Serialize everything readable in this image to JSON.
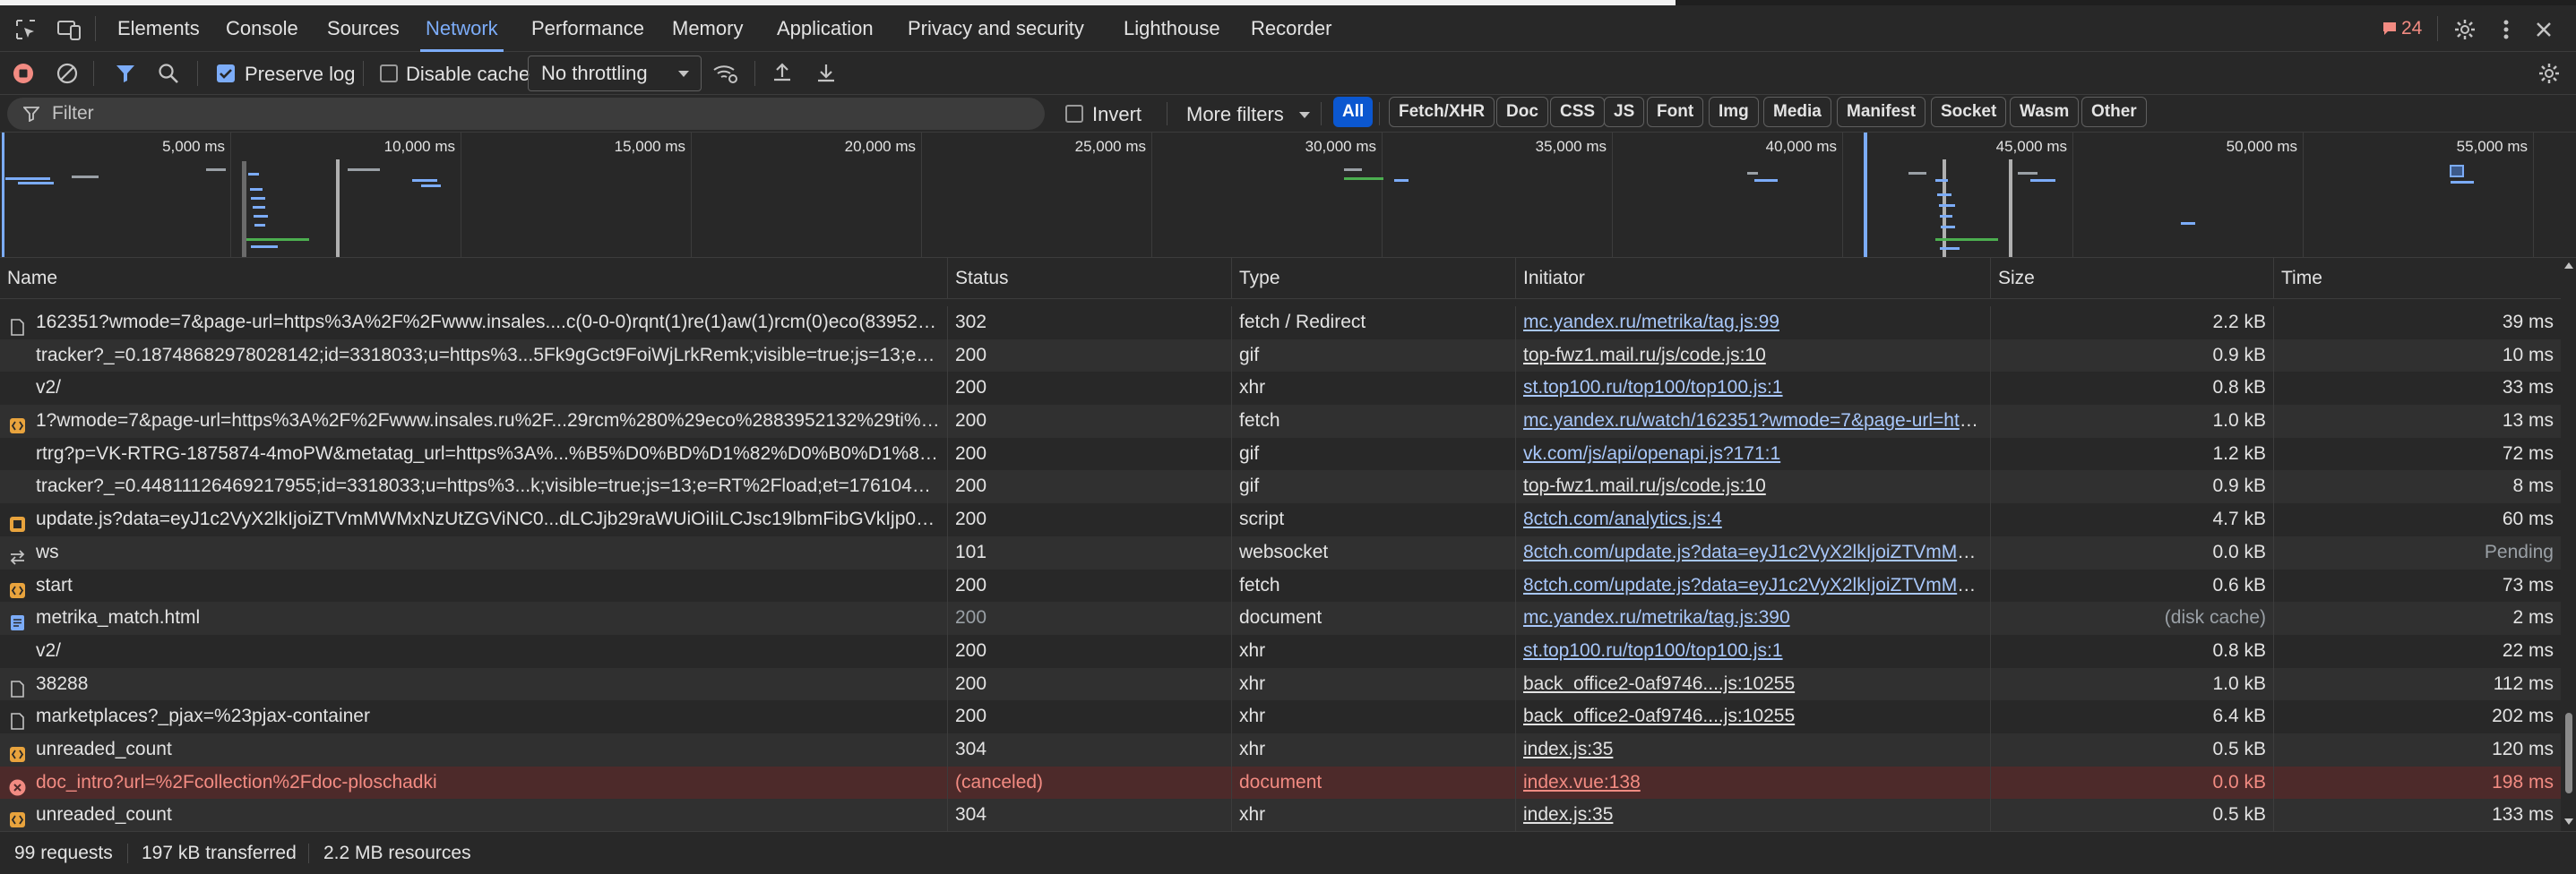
{
  "tabs": [
    {
      "label": "Elements"
    },
    {
      "label": "Console"
    },
    {
      "label": "Sources"
    },
    {
      "label": "Network"
    },
    {
      "label": "Performance"
    },
    {
      "label": "Memory"
    },
    {
      "label": "Application"
    },
    {
      "label": "Privacy and security"
    },
    {
      "label": "Lighthouse"
    },
    {
      "label": "Recorder"
    }
  ],
  "issues_count": "24",
  "toolbar": {
    "preserve_log": "Preserve log",
    "disable_cache": "Disable cache",
    "throttling": "No throttling"
  },
  "filterbar": {
    "placeholder": "Filter",
    "invert": "Invert",
    "more_filters": "More filters",
    "chips": [
      "All",
      "Fetch/XHR",
      "Doc",
      "CSS",
      "JS",
      "Font",
      "Img",
      "Media",
      "Manifest",
      "Socket",
      "Wasm",
      "Other"
    ]
  },
  "overview_ticks": [
    "5,000 ms",
    "10,000 ms",
    "15,000 ms",
    "20,000 ms",
    "25,000 ms",
    "30,000 ms",
    "35,000 ms",
    "40,000 ms",
    "45,000 ms",
    "50,000 ms",
    "55,000 ms"
  ],
  "columns": {
    "name": "Name",
    "status": "Status",
    "type": "Type",
    "initiator": "Initiator",
    "size": "Size",
    "time": "Time"
  },
  "rows": [
    {
      "icon": "doc",
      "name": "162351?wmode=7&page-url=https%3A%2F%2Fwww.insales....c(0-0-0)rqnt(1)re(1)aw(1)rcm(0)eco(8395213...",
      "status": "302",
      "type": "fetch / Redirect",
      "initiator": "mc.yandex.ru/metrika/tag.js:99",
      "size": "2.2 kB",
      "time": "39 ms"
    },
    {
      "icon": "none",
      "name": "tracker?_=0.18748682978028142;id=3318033;u=https%3...5Fk9gGct9FoiWjLrkRemk;visible=true;js=13;e=de...",
      "status": "200",
      "type": "gif",
      "initiator": "top-fwz1.mail.ru/js/code.js:10",
      "size": "0.9 kB",
      "time": "10 ms"
    },
    {
      "icon": "none",
      "name": "v2/",
      "status": "200",
      "type": "xhr",
      "initiator": "st.top100.ru/top100/top100.js:1",
      "size": "0.8 kB",
      "time": "33 ms"
    },
    {
      "icon": "fetch",
      "name": "1?wmode=7&page-url=https%3A%2F%2Fwww.insales.ru%2F...29rcm%280%29eco%2883952132%29ti%28...",
      "status": "200",
      "type": "fetch",
      "initiator": "mc.yandex.ru/watch/162351?wmode=7&page-url=https",
      "size": "1.0 kB",
      "time": "13 ms"
    },
    {
      "icon": "none",
      "name": "rtrg?p=VK-RTRG-1875874-4moPW&metatag_url=https%3A%...%B5%D0%BD%D1%82%D0%B0%D1%86%...",
      "status": "200",
      "type": "gif",
      "initiator": "vk.com/js/api/openapi.js?171:1",
      "size": "1.2 kB",
      "time": "72 ms"
    },
    {
      "icon": "none",
      "name": "tracker?_=0.44811126469217955;id=3318033;u=https%3...k;visible=true;js=13;e=RT%2Fload;et=176104552...",
      "status": "200",
      "type": "gif",
      "initiator": "top-fwz1.mail.ru/js/code.js:10",
      "size": "0.9 kB",
      "time": "8 ms"
    },
    {
      "icon": "script",
      "name": "update.js?data=eyJ1c2VyX2lkIjoiZTVmMWMxNzUtZGViNC0...dLCJjb29raWUiOiIiLCJsc19lbmFibGVkIjp0cnVlf...",
      "status": "200",
      "type": "script",
      "initiator": "8ctch.com/analytics.js:4",
      "size": "4.7 kB",
      "time": "60 ms"
    },
    {
      "icon": "ws",
      "name": "ws",
      "status": "101",
      "type": "websocket",
      "initiator": "8ctch.com/update.js?data=eyJ1c2VyX2lkIjoiZTVmMW...",
      "size": "0.0 kB",
      "time": "Pending"
    },
    {
      "icon": "fetch",
      "name": "start",
      "status": "200",
      "type": "fetch",
      "initiator": "8ctch.com/update.js?data=eyJ1c2VyX2lkIjoiZTVmMW...",
      "size": "0.6 kB",
      "time": "73 ms"
    },
    {
      "icon": "document",
      "name": "metrika_match.html",
      "status": "200",
      "type": "document",
      "initiator": "mc.yandex.ru/metrika/tag.js:390",
      "size": "(disk cache)",
      "time": "2 ms"
    },
    {
      "icon": "none",
      "name": "v2/",
      "status": "200",
      "type": "xhr",
      "initiator": "st.top100.ru/top100/top100.js:1",
      "size": "0.8 kB",
      "time": "22 ms"
    },
    {
      "icon": "doc",
      "name": "38288",
      "status": "200",
      "type": "xhr",
      "initiator": "back_office2-0af9746....js:10255",
      "size": "1.0 kB",
      "time": "112 ms"
    },
    {
      "icon": "doc",
      "name": "marketplaces?_pjax=%23pjax-container",
      "status": "200",
      "type": "xhr",
      "initiator": "back_office2-0af9746....js:10255",
      "size": "6.4 kB",
      "time": "202 ms"
    },
    {
      "icon": "fetch",
      "name": "unreaded_count",
      "status": "304",
      "type": "xhr",
      "initiator": "index.js:35",
      "size": "0.5 kB",
      "time": "120 ms"
    },
    {
      "icon": "error",
      "name": "doc_intro?url=%2Fcollection%2Fdoc-ploschadki",
      "status": "(canceled)",
      "type": "document",
      "initiator": "index.vue:138",
      "size": "0.0 kB",
      "time": "198 ms"
    },
    {
      "icon": "fetch",
      "name": "unreaded_count",
      "status": "304",
      "type": "xhr",
      "initiator": "index.js:35",
      "size": "0.5 kB",
      "time": "133 ms"
    }
  ],
  "status_bar": {
    "requests": "99 requests",
    "transferred": "197 kB transferred",
    "resources": "2.2 MB resources"
  },
  "colors": {
    "accent": "#7cacf8",
    "chip_active": "#0b57d0",
    "error_row": "#4d2a2a",
    "error_text": "#f28b82",
    "link_blue": "#a8c7fa",
    "issues_badge": "#f28b82"
  }
}
